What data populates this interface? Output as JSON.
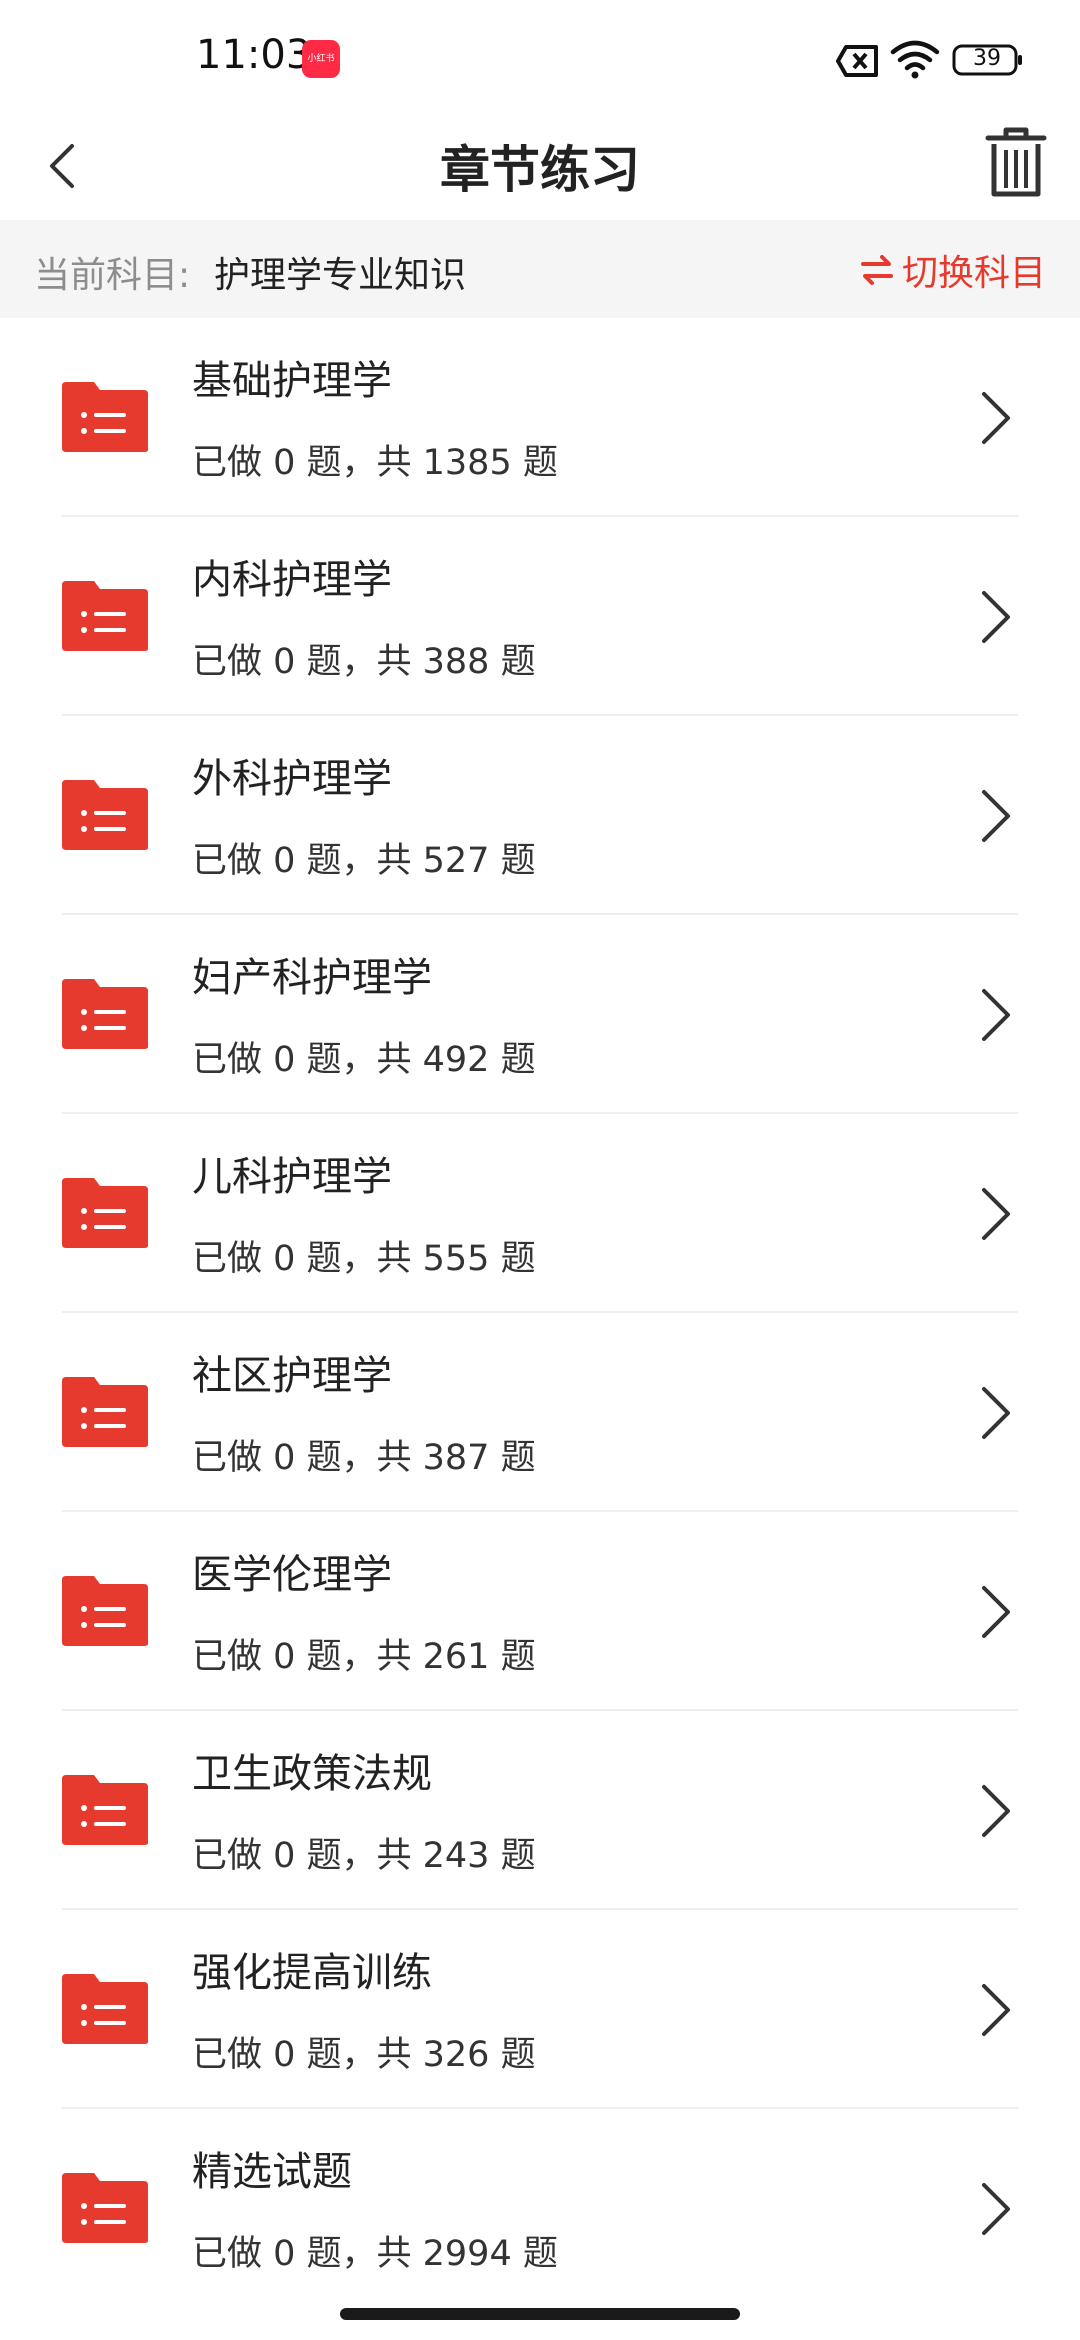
{
  "status_bar": {
    "time": "11:03",
    "app_badge": "小红书",
    "battery": "39"
  },
  "nav": {
    "title": "章节练习"
  },
  "subject": {
    "label": "当前科目:",
    "value": "护理学专业知识",
    "switch_label": "切换科目"
  },
  "chapters": [
    {
      "title": "基础护理学",
      "meta": "已做 0 题，共 1385 题"
    },
    {
      "title": "内科护理学",
      "meta": "已做 0 题，共 388 题"
    },
    {
      "title": "外科护理学",
      "meta": "已做 0 题，共 527 题"
    },
    {
      "title": "妇产科护理学",
      "meta": "已做 0 题，共 492 题"
    },
    {
      "title": "儿科护理学",
      "meta": "已做 0 题，共 555 题"
    },
    {
      "title": "社区护理学",
      "meta": "已做 0 题，共 387 题"
    },
    {
      "title": "医学伦理学",
      "meta": "已做 0 题，共 261 题"
    },
    {
      "title": "卫生政策法规",
      "meta": "已做 0 题，共 243 题"
    },
    {
      "title": "强化提高训练",
      "meta": "已做 0 题，共 326 题"
    },
    {
      "title": "精选试题",
      "meta": "已做 0 题，共 2994 题"
    }
  ],
  "colors": {
    "accent": "#e63a2e",
    "folder": "#e63a2e"
  }
}
